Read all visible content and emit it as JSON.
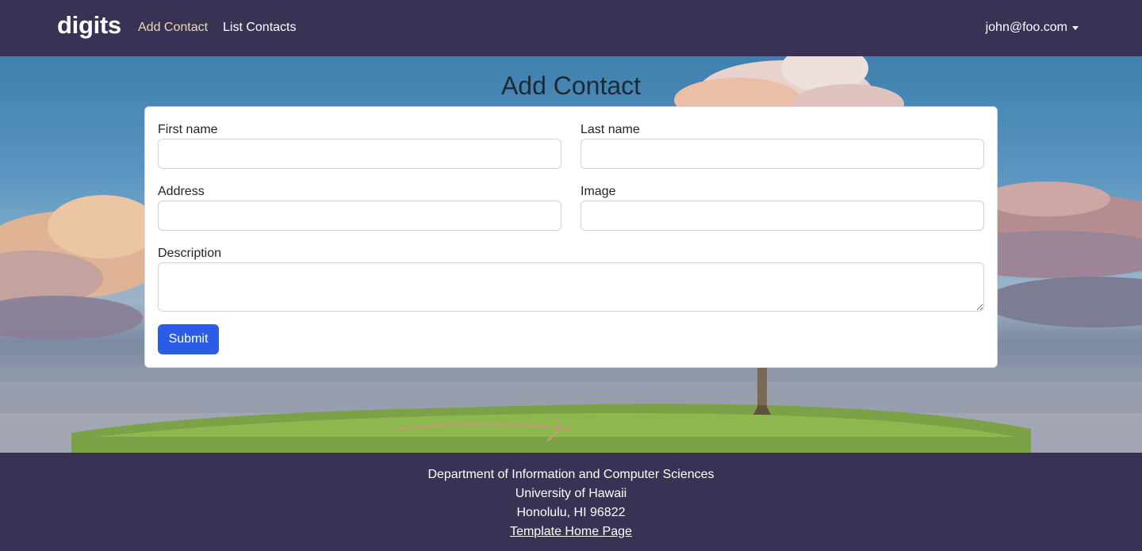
{
  "navbar": {
    "brand": "digits",
    "links": [
      {
        "label": "Add Contact",
        "active": true
      },
      {
        "label": "List Contacts",
        "active": false
      }
    ],
    "user": "john@foo.com"
  },
  "page": {
    "title": "Add Contact"
  },
  "form": {
    "first_name": {
      "label": "First name",
      "value": ""
    },
    "last_name": {
      "label": "Last name",
      "value": ""
    },
    "address": {
      "label": "Address",
      "value": ""
    },
    "image": {
      "label": "Image",
      "value": ""
    },
    "description": {
      "label": "Description",
      "value": ""
    },
    "submit_label": "Submit"
  },
  "footer": {
    "line1": "Department of Information and Computer Sciences",
    "line2": "University of Hawaii",
    "line3": "Honolulu, HI 96822",
    "link": "Template Home Page"
  },
  "colors": {
    "navbar_bg": "#383255",
    "active_link": "#f2d9b3",
    "submit_button": "#2b5ce6"
  }
}
